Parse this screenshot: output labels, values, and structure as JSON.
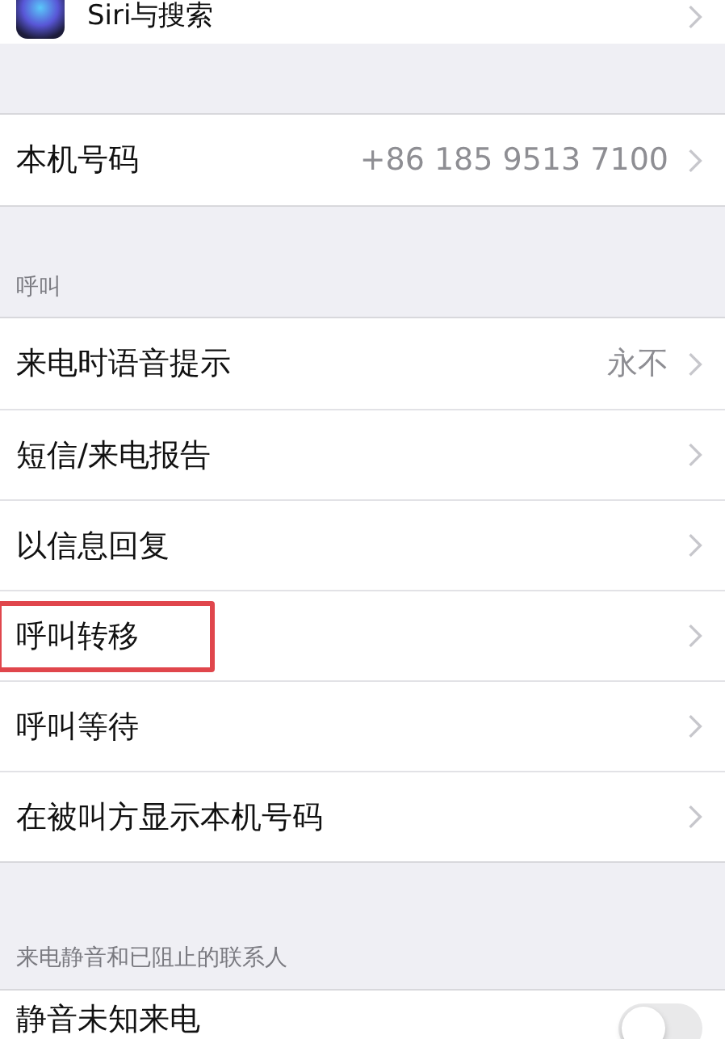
{
  "top_row": {
    "label": "Siri与搜索"
  },
  "phone_number": {
    "label": "本机号码",
    "value": "+86 185 9513 7100"
  },
  "calls": {
    "header": "呼叫",
    "items": [
      {
        "label": "来电时语音提示",
        "value": "永不",
        "highlighted": false
      },
      {
        "label": "短信/来电报告",
        "highlighted": false
      },
      {
        "label": "以信息回复",
        "highlighted": false
      },
      {
        "label": "呼叫转移",
        "highlighted": true
      },
      {
        "label": "呼叫等待",
        "highlighted": false
      },
      {
        "label": "在被叫方显示本机号码",
        "highlighted": false
      }
    ]
  },
  "silence": {
    "header": "来电静音和已阻止的联系人",
    "items": [
      {
        "label": "静音未知来电",
        "on": false
      }
    ]
  }
}
